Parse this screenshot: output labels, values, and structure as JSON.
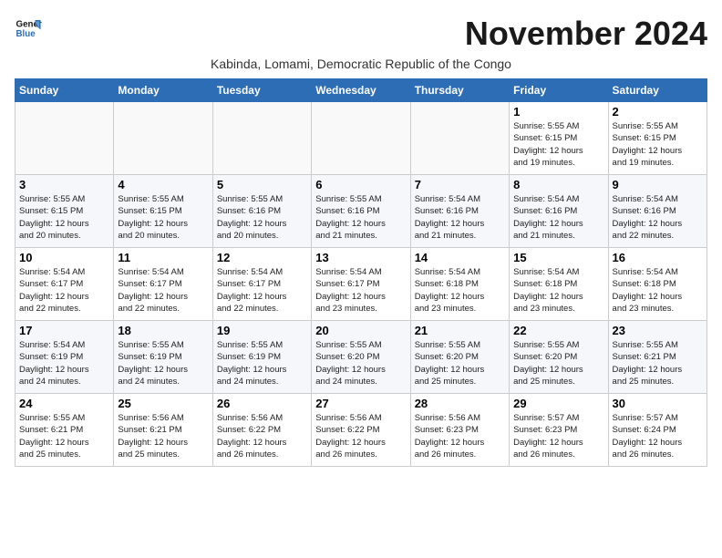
{
  "logo": {
    "line1": "General",
    "line2": "Blue"
  },
  "title": "November 2024",
  "subtitle": "Kabinda, Lomami, Democratic Republic of the Congo",
  "headers": [
    "Sunday",
    "Monday",
    "Tuesday",
    "Wednesday",
    "Thursday",
    "Friday",
    "Saturday"
  ],
  "weeks": [
    [
      {
        "day": "",
        "detail": ""
      },
      {
        "day": "",
        "detail": ""
      },
      {
        "day": "",
        "detail": ""
      },
      {
        "day": "",
        "detail": ""
      },
      {
        "day": "",
        "detail": ""
      },
      {
        "day": "1",
        "detail": "Sunrise: 5:55 AM\nSunset: 6:15 PM\nDaylight: 12 hours\nand 19 minutes."
      },
      {
        "day": "2",
        "detail": "Sunrise: 5:55 AM\nSunset: 6:15 PM\nDaylight: 12 hours\nand 19 minutes."
      }
    ],
    [
      {
        "day": "3",
        "detail": "Sunrise: 5:55 AM\nSunset: 6:15 PM\nDaylight: 12 hours\nand 20 minutes."
      },
      {
        "day": "4",
        "detail": "Sunrise: 5:55 AM\nSunset: 6:15 PM\nDaylight: 12 hours\nand 20 minutes."
      },
      {
        "day": "5",
        "detail": "Sunrise: 5:55 AM\nSunset: 6:16 PM\nDaylight: 12 hours\nand 20 minutes."
      },
      {
        "day": "6",
        "detail": "Sunrise: 5:55 AM\nSunset: 6:16 PM\nDaylight: 12 hours\nand 21 minutes."
      },
      {
        "day": "7",
        "detail": "Sunrise: 5:54 AM\nSunset: 6:16 PM\nDaylight: 12 hours\nand 21 minutes."
      },
      {
        "day": "8",
        "detail": "Sunrise: 5:54 AM\nSunset: 6:16 PM\nDaylight: 12 hours\nand 21 minutes."
      },
      {
        "day": "9",
        "detail": "Sunrise: 5:54 AM\nSunset: 6:16 PM\nDaylight: 12 hours\nand 22 minutes."
      }
    ],
    [
      {
        "day": "10",
        "detail": "Sunrise: 5:54 AM\nSunset: 6:17 PM\nDaylight: 12 hours\nand 22 minutes."
      },
      {
        "day": "11",
        "detail": "Sunrise: 5:54 AM\nSunset: 6:17 PM\nDaylight: 12 hours\nand 22 minutes."
      },
      {
        "day": "12",
        "detail": "Sunrise: 5:54 AM\nSunset: 6:17 PM\nDaylight: 12 hours\nand 22 minutes."
      },
      {
        "day": "13",
        "detail": "Sunrise: 5:54 AM\nSunset: 6:17 PM\nDaylight: 12 hours\nand 23 minutes."
      },
      {
        "day": "14",
        "detail": "Sunrise: 5:54 AM\nSunset: 6:18 PM\nDaylight: 12 hours\nand 23 minutes."
      },
      {
        "day": "15",
        "detail": "Sunrise: 5:54 AM\nSunset: 6:18 PM\nDaylight: 12 hours\nand 23 minutes."
      },
      {
        "day": "16",
        "detail": "Sunrise: 5:54 AM\nSunset: 6:18 PM\nDaylight: 12 hours\nand 23 minutes."
      }
    ],
    [
      {
        "day": "17",
        "detail": "Sunrise: 5:54 AM\nSunset: 6:19 PM\nDaylight: 12 hours\nand 24 minutes."
      },
      {
        "day": "18",
        "detail": "Sunrise: 5:55 AM\nSunset: 6:19 PM\nDaylight: 12 hours\nand 24 minutes."
      },
      {
        "day": "19",
        "detail": "Sunrise: 5:55 AM\nSunset: 6:19 PM\nDaylight: 12 hours\nand 24 minutes."
      },
      {
        "day": "20",
        "detail": "Sunrise: 5:55 AM\nSunset: 6:20 PM\nDaylight: 12 hours\nand 24 minutes."
      },
      {
        "day": "21",
        "detail": "Sunrise: 5:55 AM\nSunset: 6:20 PM\nDaylight: 12 hours\nand 25 minutes."
      },
      {
        "day": "22",
        "detail": "Sunrise: 5:55 AM\nSunset: 6:20 PM\nDaylight: 12 hours\nand 25 minutes."
      },
      {
        "day": "23",
        "detail": "Sunrise: 5:55 AM\nSunset: 6:21 PM\nDaylight: 12 hours\nand 25 minutes."
      }
    ],
    [
      {
        "day": "24",
        "detail": "Sunrise: 5:55 AM\nSunset: 6:21 PM\nDaylight: 12 hours\nand 25 minutes."
      },
      {
        "day": "25",
        "detail": "Sunrise: 5:56 AM\nSunset: 6:21 PM\nDaylight: 12 hours\nand 25 minutes."
      },
      {
        "day": "26",
        "detail": "Sunrise: 5:56 AM\nSunset: 6:22 PM\nDaylight: 12 hours\nand 26 minutes."
      },
      {
        "day": "27",
        "detail": "Sunrise: 5:56 AM\nSunset: 6:22 PM\nDaylight: 12 hours\nand 26 minutes."
      },
      {
        "day": "28",
        "detail": "Sunrise: 5:56 AM\nSunset: 6:23 PM\nDaylight: 12 hours\nand 26 minutes."
      },
      {
        "day": "29",
        "detail": "Sunrise: 5:57 AM\nSunset: 6:23 PM\nDaylight: 12 hours\nand 26 minutes."
      },
      {
        "day": "30",
        "detail": "Sunrise: 5:57 AM\nSunset: 6:24 PM\nDaylight: 12 hours\nand 26 minutes."
      }
    ]
  ]
}
